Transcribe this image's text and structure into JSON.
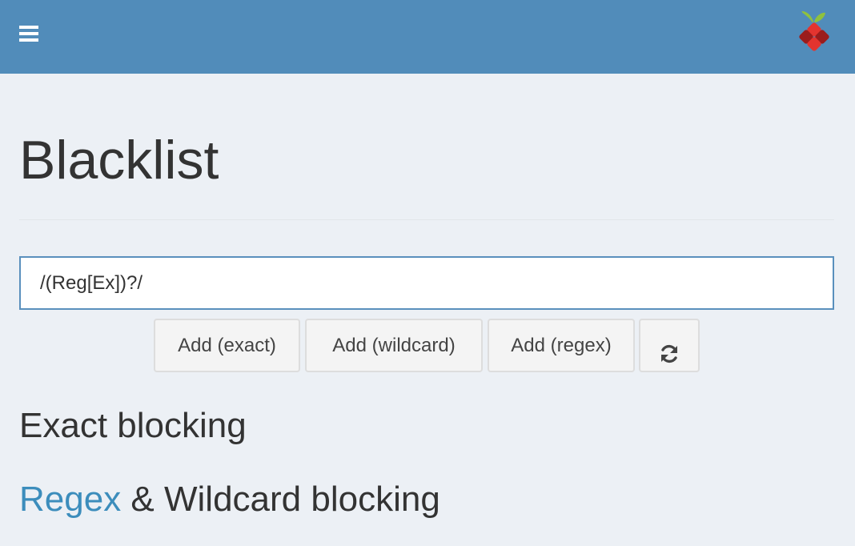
{
  "header": {
    "menu_icon": "hamburger-menu-icon",
    "logo_icon": "pi-hole-logo-icon",
    "background_color": "#518cba"
  },
  "main": {
    "title": "Blacklist",
    "domain_input": {
      "value": "/(Reg[Ex])?/"
    },
    "buttons": {
      "add_exact": "Add (exact)",
      "add_wildcard": "Add (wildcard)",
      "add_regex": "Add (regex)",
      "refresh_icon": "refresh-icon"
    },
    "sections": {
      "exact_heading": "Exact blocking",
      "regex_link": "Regex",
      "regex_heading_rest": "& Wildcard blocking"
    },
    "colors": {
      "background": "#ecf0f5",
      "link": "#3c8dbc",
      "input_border": "#5a90bd"
    }
  }
}
